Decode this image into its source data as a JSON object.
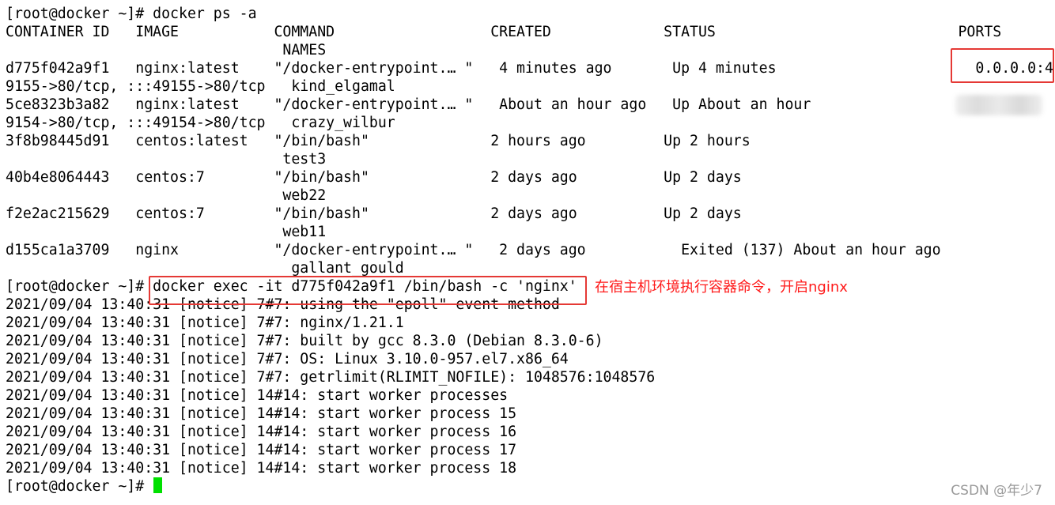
{
  "terminal": {
    "lines": [
      "[root@docker ~]# docker ps -a",
      "CONTAINER ID   IMAGE           COMMAND                  CREATED             STATUS                            PORTS",
      "                                NAMES",
      "d775f042a9f1   nginx:latest    \"/docker-entrypoint.… \"   4 minutes ago       Up 4 minutes                       0.0.0.0:4",
      "9155->80/tcp, :::49155->80/tcp   kind_elgamal",
      "5ce8323b3a82   nginx:latest    \"/docker-entrypoint.… \"   About an hour ago   Up About an hour",
      "9154->80/tcp, :::49154->80/tcp   crazy_wilbur",
      "3f8b98445d91   centos:latest   \"/bin/bash\"              2 hours ago         Up 2 hours",
      "                                test3",
      "40b4e8064443   centos:7        \"/bin/bash\"              2 days ago          Up 2 days",
      "                                web22",
      "f2e2ac215629   centos:7        \"/bin/bash\"              2 days ago          Up 2 days",
      "                                web11",
      "d155ca1a3709   nginx           \"/docker-entrypoint.… \"   2 days ago           Exited (137) About an hour ago",
      "                                 gallant_gould",
      "[root@docker ~]# docker exec -it d775f042a9f1 /bin/bash -c 'nginx'",
      "2021/09/04 13:40:31 [notice] 7#7: using the \"epoll\" event method",
      "2021/09/04 13:40:31 [notice] 7#7: nginx/1.21.1",
      "2021/09/04 13:40:31 [notice] 7#7: built by gcc 8.3.0 (Debian 8.3.0-6)",
      "2021/09/04 13:40:31 [notice] 7#7: OS: Linux 3.10.0-957.el7.x86_64",
      "2021/09/04 13:40:31 [notice] 7#7: getrlimit(RLIMIT_NOFILE): 1048576:1048576",
      "2021/09/04 13:40:31 [notice] 14#14: start worker processes",
      "2021/09/04 13:40:31 [notice] 14#14: start worker process 15",
      "2021/09/04 13:40:31 [notice] 14#14: start worker process 16",
      "2021/09/04 13:40:31 [notice] 14#14: start worker process 17",
      "2021/09/04 13:40:31 [notice] 14#14: start worker process 18",
      "[root@docker ~]# "
    ],
    "cursor_color": "#00e000",
    "background": "#ffffff"
  },
  "annotations": {
    "highlight_color": "#e53935",
    "command_note": "在宿主机环境执行容器命令，开启nginx"
  },
  "watermark": "CSDN @年少7"
}
